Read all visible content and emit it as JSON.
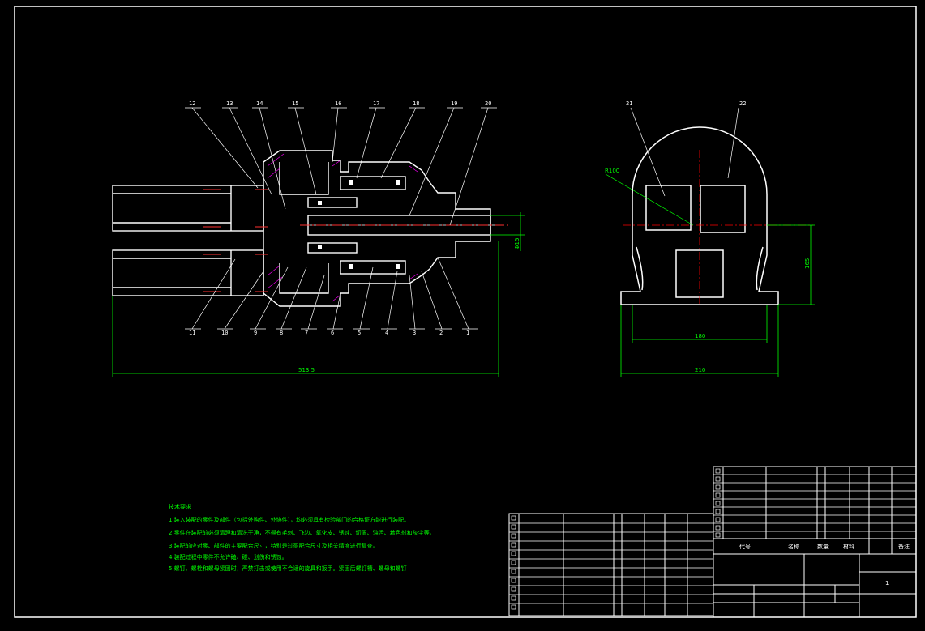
{
  "colors": {
    "background": "#000000",
    "outline": "#ffffff",
    "dimension": "#00ff00",
    "centerline": "#ff0000",
    "section": "#ff00ff",
    "fastener": "#ff3030"
  },
  "balloons_top": [
    "12",
    "13",
    "14",
    "15",
    "16",
    "17",
    "18",
    "19",
    "20"
  ],
  "balloons_bottom": [
    "11",
    "10",
    "9",
    "8",
    "7",
    "6",
    "5",
    "4",
    "3",
    "2",
    "1"
  ],
  "side_balloons": [
    "21",
    "22"
  ],
  "dimensions": {
    "overall_length": "513.5",
    "shaft_diameter": "Φ15",
    "radius": "R100",
    "height": "165",
    "inner_width": "180",
    "base_width": "210"
  },
  "tech_notes": {
    "title": "技术要求",
    "lines": [
      "1.装入装配的零件及部件（包括外购件、外协件），均必须具有检验部门的合格证方能进行装配。",
      "2.零件在装配前必须清理和清洗干净，不得有毛刺、飞边、氧化皮、锈蚀、切屑、油污、着色剂和灰尘等。",
      "3.装配前应对零、部件的主要配合尺寸，特别是过盈配合尺寸及相关精度进行复查。",
      "4.装配过程中零件不允许磕、碰、划伤和锈蚀。",
      "5.螺钉、螺栓和螺母紧固时，严禁打击或使用不合适的旋具和扳手。紧固后螺钉槽、螺母和螺钉"
    ]
  },
  "title_block": {
    "header_code": "代号",
    "header_name": "名称",
    "header_qty": "数量",
    "header_material": "材料",
    "header_remark": "备注",
    "sheet": "1"
  }
}
